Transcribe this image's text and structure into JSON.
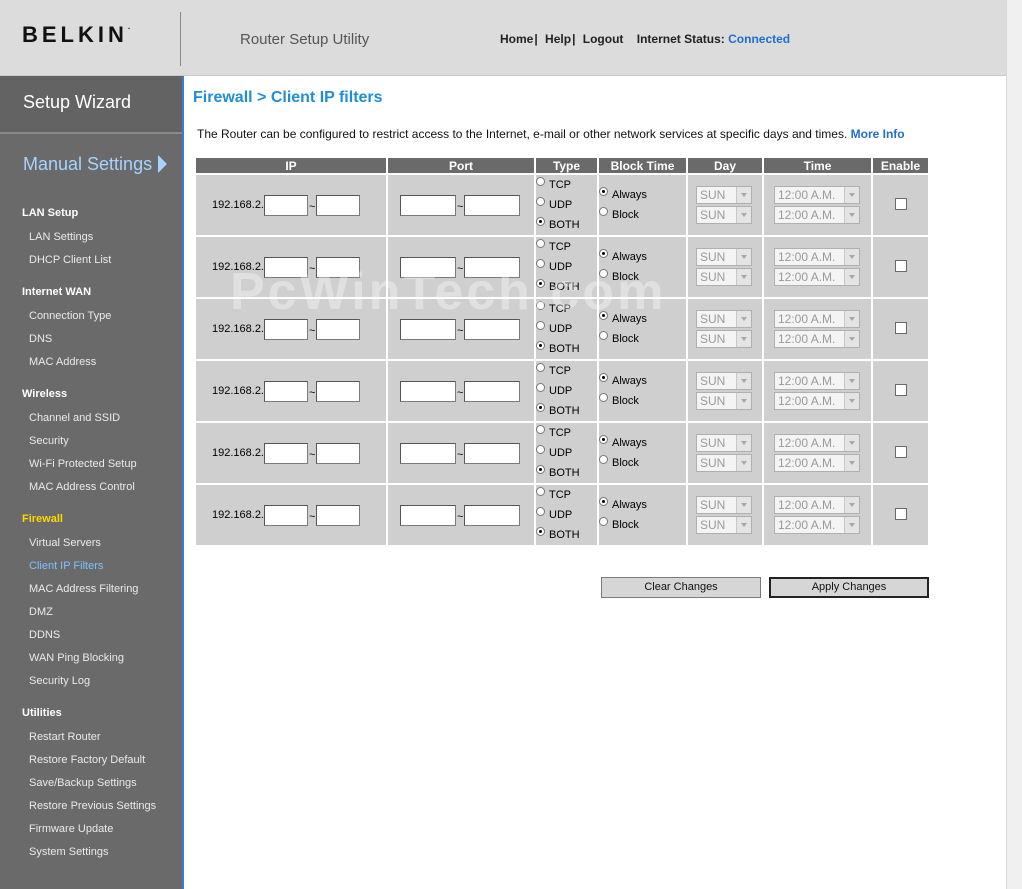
{
  "header": {
    "logo": "BELKIN",
    "logo_mark": ".",
    "utility_title": "Router Setup Utility",
    "nav": [
      "Home",
      "Help",
      "Logout"
    ],
    "nav_sep": "|",
    "status_label": "Internet Status:",
    "status_value": "Connected"
  },
  "sidebar": {
    "setup_wizard": "Setup Wizard",
    "manual_settings": "Manual Settings",
    "sections": [
      {
        "title": "LAN Setup",
        "items": [
          "LAN Settings",
          "DHCP Client List"
        ]
      },
      {
        "title": "Internet WAN",
        "items": [
          "Connection Type",
          "DNS",
          "MAC Address"
        ]
      },
      {
        "title": "Wireless",
        "items": [
          "Channel and SSID",
          "Security",
          "Wi-Fi Protected Setup",
          "MAC Address Control"
        ]
      },
      {
        "title": "Firewall",
        "items": [
          "Virtual Servers",
          "Client IP Filters",
          "MAC Address Filtering",
          "DMZ",
          "DDNS",
          "WAN Ping Blocking",
          "Security Log"
        ]
      },
      {
        "title": "Utilities",
        "items": [
          "Restart Router",
          "Restore Factory Default",
          "Save/Backup Settings",
          "Restore Previous Settings",
          "Firmware Update",
          "System Settings"
        ]
      }
    ]
  },
  "main": {
    "title": "Firewall > Client IP filters",
    "intro": "The Router can be configured to restrict access to the Internet, e-mail or other network services at specific days and times.",
    "more_info": "More Info",
    "columns": [
      "IP",
      "Port",
      "Type",
      "Block Time",
      "Day",
      "Time",
      "Enable"
    ],
    "rows": [
      {
        "ip_prefix": "192.168.2.",
        "tilde": "~",
        "types": [
          "TCP",
          "UDP",
          "BOTH"
        ],
        "type_selected": "BOTH",
        "block": [
          "Always",
          "Block"
        ],
        "block_selected": "Always",
        "day_from": "SUN",
        "day_to": "SUN",
        "time_from": "12:00 A.M.",
        "time_to": "12:00 A.M.",
        "enabled": false
      },
      {
        "ip_prefix": "192.168.2.",
        "tilde": "~",
        "types": [
          "TCP",
          "UDP",
          "BOTH"
        ],
        "type_selected": "BOTH",
        "block": [
          "Always",
          "Block"
        ],
        "block_selected": "Always",
        "day_from": "SUN",
        "day_to": "SUN",
        "time_from": "12:00 A.M.",
        "time_to": "12:00 A.M.",
        "enabled": false
      },
      {
        "ip_prefix": "192.168.2.",
        "tilde": "~",
        "types": [
          "TCP",
          "UDP",
          "BOTH"
        ],
        "type_selected": "BOTH",
        "block": [
          "Always",
          "Block"
        ],
        "block_selected": "Always",
        "day_from": "SUN",
        "day_to": "SUN",
        "time_from": "12:00 A.M.",
        "time_to": "12:00 A.M.",
        "enabled": false
      },
      {
        "ip_prefix": "192.168.2.",
        "tilde": "~",
        "types": [
          "TCP",
          "UDP",
          "BOTH"
        ],
        "type_selected": "BOTH",
        "block": [
          "Always",
          "Block"
        ],
        "block_selected": "Always",
        "day_from": "SUN",
        "day_to": "SUN",
        "time_from": "12:00 A.M.",
        "time_to": "12:00 A.M.",
        "enabled": false
      },
      {
        "ip_prefix": "192.168.2.",
        "tilde": "~",
        "types": [
          "TCP",
          "UDP",
          "BOTH"
        ],
        "type_selected": "BOTH",
        "block": [
          "Always",
          "Block"
        ],
        "block_selected": "Always",
        "day_from": "SUN",
        "day_to": "SUN",
        "time_from": "12:00 A.M.",
        "time_to": "12:00 A.M.",
        "enabled": false
      },
      {
        "ip_prefix": "192.168.2.",
        "tilde": "~",
        "types": [
          "TCP",
          "UDP",
          "BOTH"
        ],
        "type_selected": "BOTH",
        "block": [
          "Always",
          "Block"
        ],
        "block_selected": "Always",
        "day_from": "SUN",
        "day_to": "SUN",
        "time_from": "12:00 A.M.",
        "time_to": "12:00 A.M.",
        "enabled": false
      }
    ],
    "clear_label": "Clear Changes",
    "apply_label": "Apply Changes"
  },
  "watermark": "PcWinTech.com",
  "colors": {
    "accent": "#1f8ed8",
    "sidebar_bg": "#6a6a6a",
    "active_section": "#ffd700",
    "active_item": "#7fc0ff"
  }
}
